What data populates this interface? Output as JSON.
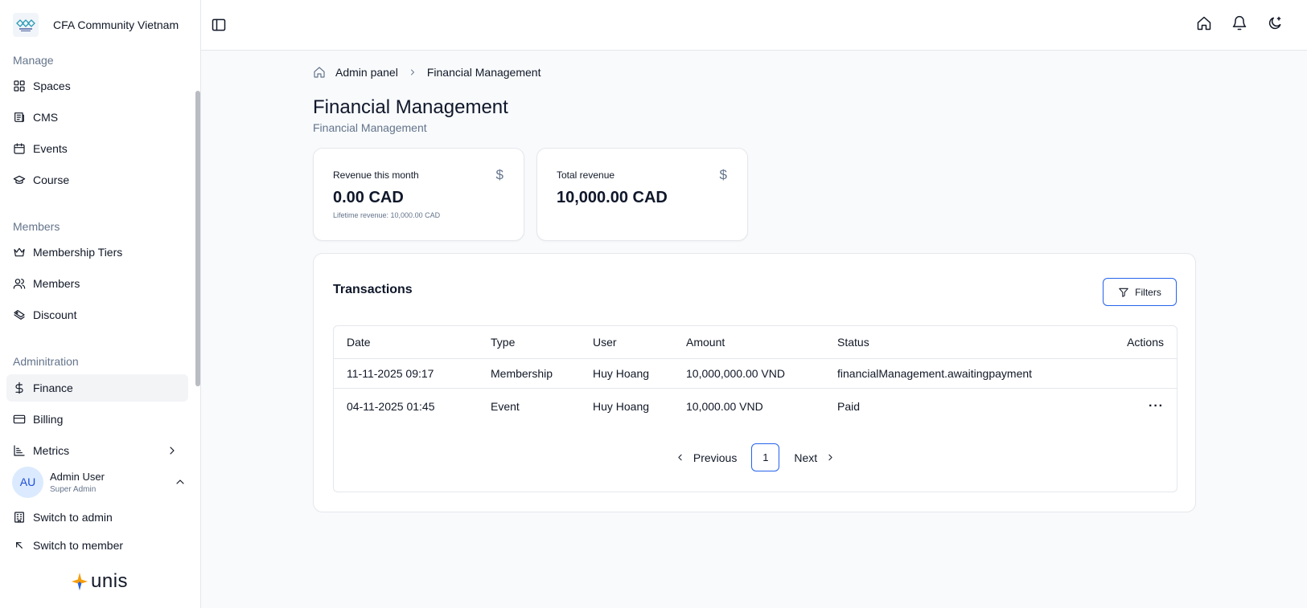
{
  "brand": {
    "name": "CFA Community Vietnam"
  },
  "sidebar": {
    "sections": [
      {
        "label": "Manage",
        "items": [
          {
            "label": "Spaces",
            "icon": "grid-icon"
          },
          {
            "label": "CMS",
            "icon": "newspaper-icon"
          },
          {
            "label": "Events",
            "icon": "calendar-icon"
          },
          {
            "label": "Course",
            "icon": "graduation-cap-icon"
          }
        ]
      },
      {
        "label": "Members",
        "items": [
          {
            "label": "Membership Tiers",
            "icon": "crown-icon"
          },
          {
            "label": "Members",
            "icon": "users-icon"
          },
          {
            "label": "Discount",
            "icon": "tickets-icon"
          }
        ]
      },
      {
        "label": "Adminitration",
        "items": [
          {
            "label": "Finance",
            "icon": "dollar-icon",
            "active": true
          },
          {
            "label": "Billing",
            "icon": "credit-card-icon"
          },
          {
            "label": "Metrics",
            "icon": "chart-icon"
          }
        ]
      }
    ],
    "user": {
      "initials": "AU",
      "name": "Admin User",
      "role": "Super Admin"
    },
    "switch_admin": "Switch to admin",
    "switch_member": "Switch to member",
    "footer_logo": "unis"
  },
  "breadcrumb": {
    "root": "Admin panel",
    "current": "Financial Management"
  },
  "page": {
    "title": "Financial Management",
    "subtitle": "Financial Management"
  },
  "stats": [
    {
      "label": "Revenue this month",
      "value": "0.00 CAD",
      "note": "Lifetime revenue: 10,000.00 CAD",
      "icon": "$"
    },
    {
      "label": "Total revenue",
      "value": "10,000.00 CAD",
      "icon": "$"
    }
  ],
  "transactions": {
    "title": "Transactions",
    "filters_label": "Filters",
    "columns": [
      "Date",
      "Type",
      "User",
      "Amount",
      "Status",
      "Actions"
    ],
    "rows": [
      {
        "date": "11-11-2025 09:17",
        "type": "Membership",
        "user": "Huy Hoang",
        "amount": "10,000,000.00 VND",
        "status": "financialManagement.awaitingpayment"
      },
      {
        "date": "04-11-2025 01:45",
        "type": "Event",
        "user": "Huy Hoang",
        "amount": "10,000.00 VND",
        "status": "Paid",
        "actions": "···"
      }
    ],
    "pagination": {
      "previous": "Previous",
      "current": "1",
      "next": "Next"
    }
  },
  "colors": {
    "accent": "#2563eb",
    "muted": "#64748b",
    "border": "#e5e7eb"
  }
}
